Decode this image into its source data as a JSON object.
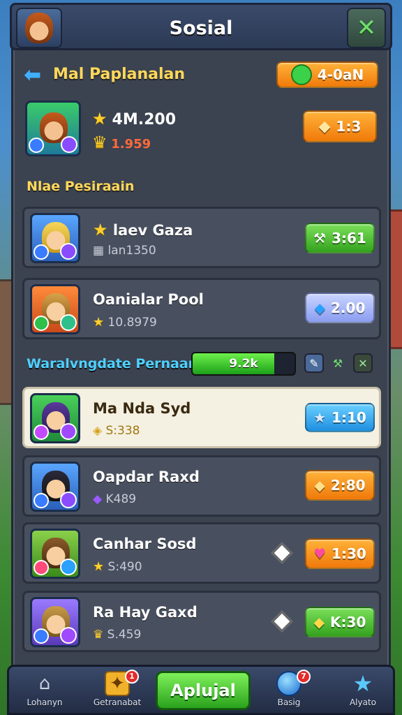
{
  "header": {
    "title": "Sosial",
    "close_icon": "close-icon"
  },
  "top_row": {
    "label": "Mal Paplanalan",
    "button_value": "4-0aN",
    "button_icon": "green-coin-icon"
  },
  "player": {
    "stat1": "4M.200",
    "stat2": "1.959",
    "button_value": "1:3"
  },
  "section1": {
    "title": "Nlae Pesiraain"
  },
  "cards_top": [
    {
      "name": "laev Gaza",
      "sub": "lan1350",
      "button_value": "3:61",
      "button_color": "#43b82a"
    },
    {
      "name": "Oanialar Pool",
      "sub": "10.8979",
      "button_value": "2.00",
      "button_color": "#8a9df0"
    }
  ],
  "progress": {
    "label": "Waralvngdate Pernaan",
    "bar_text": "9.2k",
    "fill": 0.8
  },
  "cards_bottom": [
    {
      "name": "Ma Nda Syd",
      "sub": "S:338",
      "button_value": "1:10",
      "button_color": "#1f8fe0",
      "highlight": true
    },
    {
      "name": "Oapdar Raxd",
      "sub": "K489",
      "button_value": "2:80",
      "button_color": "#f07a0a"
    },
    {
      "name": "Canhar Sosd",
      "sub": "S:490",
      "button_value": "1:30",
      "button_color": "#f07a0a"
    },
    {
      "name": "Ra Hay Gaxd",
      "sub": "S.459",
      "button_value": "K:30",
      "button_color": "#33a21e"
    }
  ],
  "bottom_nav": {
    "items": [
      {
        "label": "Lohanyn",
        "icon": "home-icon"
      },
      {
        "label": "Getranabat",
        "icon": "chest-icon",
        "badge": "1"
      },
      {
        "label": "Aplujal",
        "icon": "main-action"
      },
      {
        "label": "Basig",
        "icon": "orb-icon",
        "badge": "7"
      },
      {
        "label": "Alyato",
        "icon": "star-icon"
      }
    ]
  }
}
